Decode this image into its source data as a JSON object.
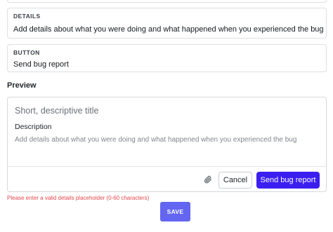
{
  "colors": {
    "accent": "#3b1ff0",
    "save_button": "#6366f1",
    "error": "#e5484d"
  },
  "details_field": {
    "label": "DETAILS",
    "value": "Add details about what you were doing and what happened when you experienced the bug"
  },
  "button_field": {
    "label": "BUTTON",
    "value": "Send bug report"
  },
  "preview": {
    "heading": "Preview",
    "title_placeholder": "Short, descriptive title",
    "description_label": "Description",
    "description_placeholder": "Add details about what you were doing and what happened when you experienced the bug",
    "attach_icon": "paperclip-icon",
    "cancel_label": "Cancel",
    "send_label": "Send bug report"
  },
  "validation": {
    "error_message": "Please enter a valid details placeholder (0-60 characters)"
  },
  "save_label": "SAVE"
}
